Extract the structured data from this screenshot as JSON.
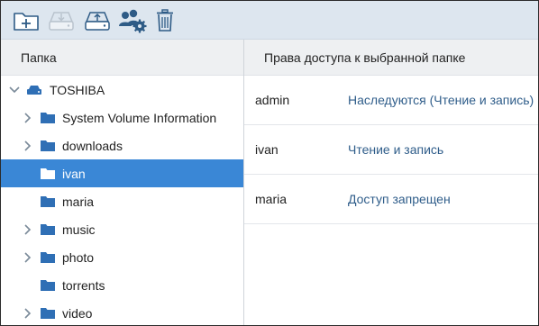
{
  "toolbar": {
    "buttons": [
      {
        "name": "new-folder-icon"
      },
      {
        "name": "download-disk-icon"
      },
      {
        "name": "upload-disk-icon"
      },
      {
        "name": "users-settings-icon"
      },
      {
        "name": "trash-icon"
      }
    ]
  },
  "tree": {
    "header": "Папка",
    "root": {
      "label": "TOSHIBA"
    },
    "items": [
      {
        "label": "System Volume Information",
        "expandable": true,
        "selected": false
      },
      {
        "label": "downloads",
        "expandable": true,
        "selected": false
      },
      {
        "label": "ivan",
        "expandable": false,
        "selected": true
      },
      {
        "label": "maria",
        "expandable": false,
        "selected": false
      },
      {
        "label": "music",
        "expandable": true,
        "selected": false
      },
      {
        "label": "photo",
        "expandable": true,
        "selected": false
      },
      {
        "label": "torrents",
        "expandable": false,
        "selected": false
      },
      {
        "label": "video",
        "expandable": true,
        "selected": false
      }
    ]
  },
  "permissions": {
    "header": "Права доступа к выбранной папке",
    "rows": [
      {
        "user": "admin",
        "access": "Наследуются (Чтение и запись)"
      },
      {
        "user": "ivan",
        "access": "Чтение и запись"
      },
      {
        "user": "maria",
        "access": "Доступ запрещен"
      }
    ]
  },
  "colors": {
    "toolbar_bg": "#dde6ef",
    "selection": "#3a87d6",
    "folder": "#2f6fb5",
    "link": "#2f5d8a"
  }
}
